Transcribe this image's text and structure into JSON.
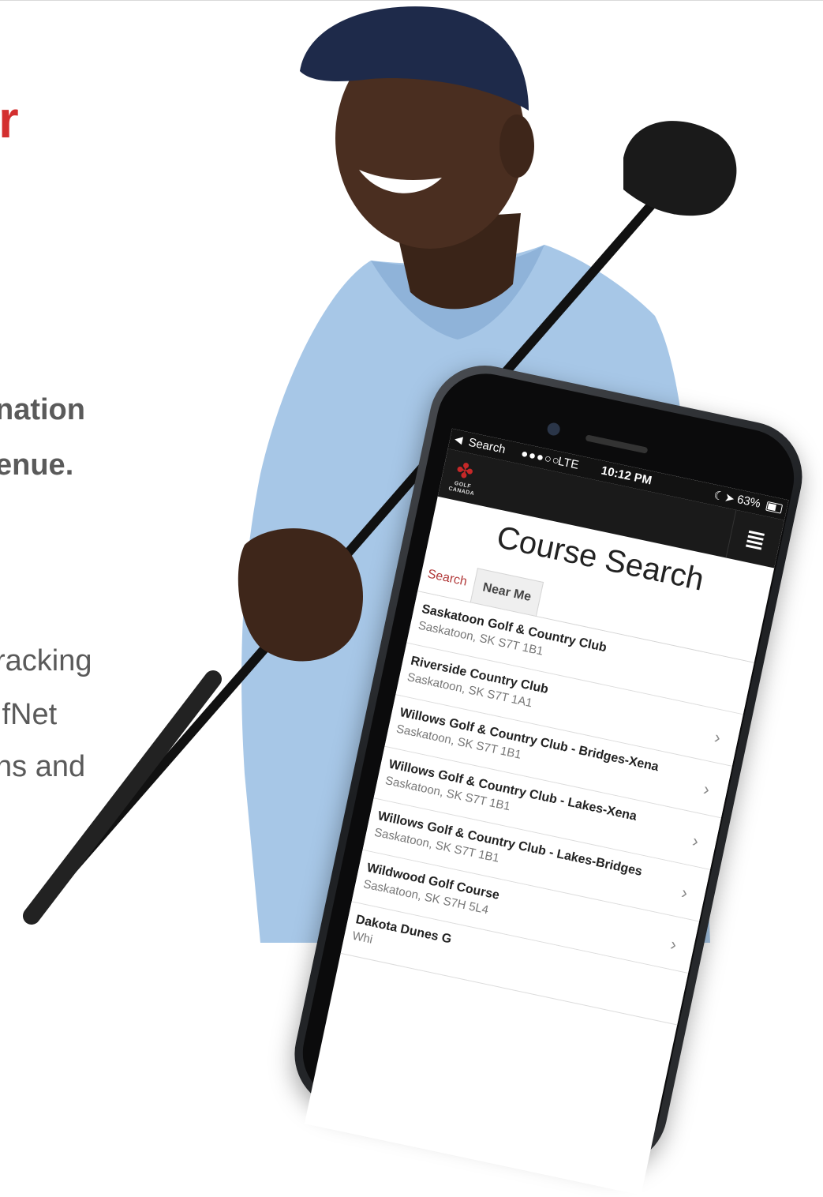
{
  "slide": {
    "headline_fragment": "r",
    "bold_lines": [
      "nation",
      "enue."
    ],
    "body_lines": [
      "racking",
      "lfNet",
      "ns and"
    ]
  },
  "phone": {
    "status_bar": {
      "back_label": "Search",
      "signal": "●●●○○",
      "network": "LTE",
      "time": "10:12 PM",
      "battery": "63%"
    },
    "app": {
      "logo_text": "GOLF CANADA",
      "page_title": "Course Search",
      "tabs": [
        {
          "label": "Search",
          "active": false
        },
        {
          "label": "Near Me",
          "active": true
        }
      ],
      "courses": [
        {
          "name": "Saskatoon Golf & Country Club",
          "address": "Saskatoon, SK S7T 1B1"
        },
        {
          "name": "Riverside Country Club",
          "address": "Saskatoon, SK S7T 1A1"
        },
        {
          "name": "Willows Golf & Country Club - Bridges-Xena",
          "address": "Saskatoon, SK S7T 1B1"
        },
        {
          "name": "Willows Golf & Country Club - Lakes-Xena",
          "address": "Saskatoon, SK S7T 1B1"
        },
        {
          "name": "Willows Golf & Country Club - Lakes-Bridges",
          "address": "Saskatoon, SK S7T 1B1"
        },
        {
          "name": "Wildwood Golf Course",
          "address": "Saskatoon, SK S7H 5L4"
        },
        {
          "name": "Dakota Dunes G",
          "address": "Whi"
        }
      ]
    }
  },
  "colors": {
    "accent_red": "#d32f2f",
    "text_gray": "#5a5a5a",
    "shirt_blue": "#9cc0e4",
    "cap_navy": "#1e2a4a"
  }
}
